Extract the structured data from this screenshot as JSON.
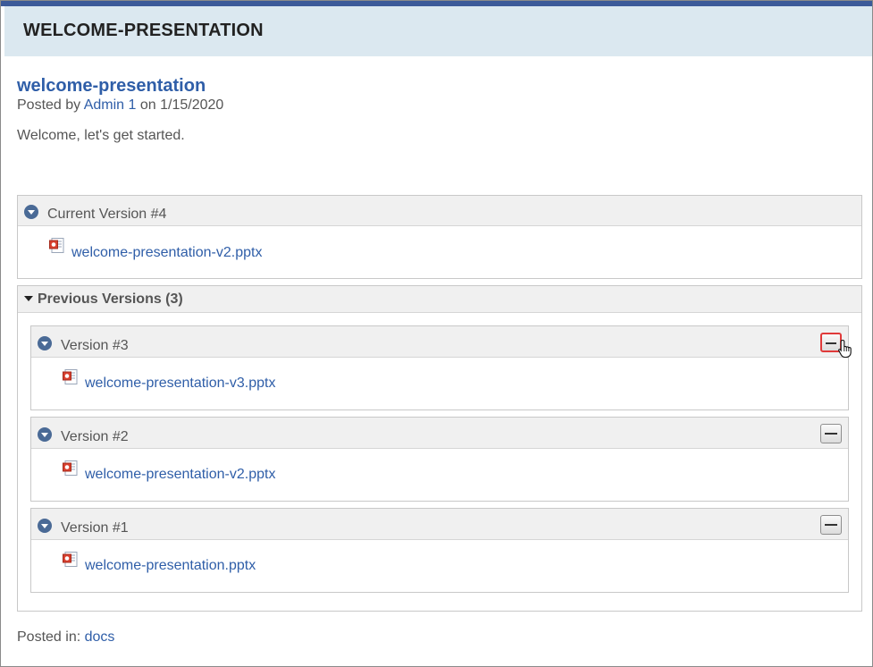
{
  "header": {
    "title": "WELCOME-PRESENTATION"
  },
  "post": {
    "title": "welcome-presentation",
    "posted_by_prefix": "Posted by",
    "author": "Admin 1",
    "date_text": "on 1/15/2020",
    "body": "Welcome, let's get started."
  },
  "current_version": {
    "label": "Current Version #4",
    "file": "welcome-presentation-v2.pptx"
  },
  "previous_versions": {
    "label": "Previous Versions (3)",
    "items": [
      {
        "label": "Version #3",
        "file": "welcome-presentation-v3.pptx"
      },
      {
        "label": "Version #2",
        "file": "welcome-presentation-v2.pptx"
      },
      {
        "label": "Version #1",
        "file": "welcome-presentation.pptx"
      }
    ]
  },
  "footer": {
    "posted_in_label": "Posted in:",
    "category": "docs"
  },
  "colors": {
    "accent": "#3c5a99",
    "link": "#2f5ea8",
    "header_bg": "#dbe8f0",
    "highlight": "#e03a3a"
  },
  "icons": {
    "version_toggle": "chevron-down-circle-icon",
    "file": "pptx-file-icon",
    "remove": "minus-icon"
  }
}
